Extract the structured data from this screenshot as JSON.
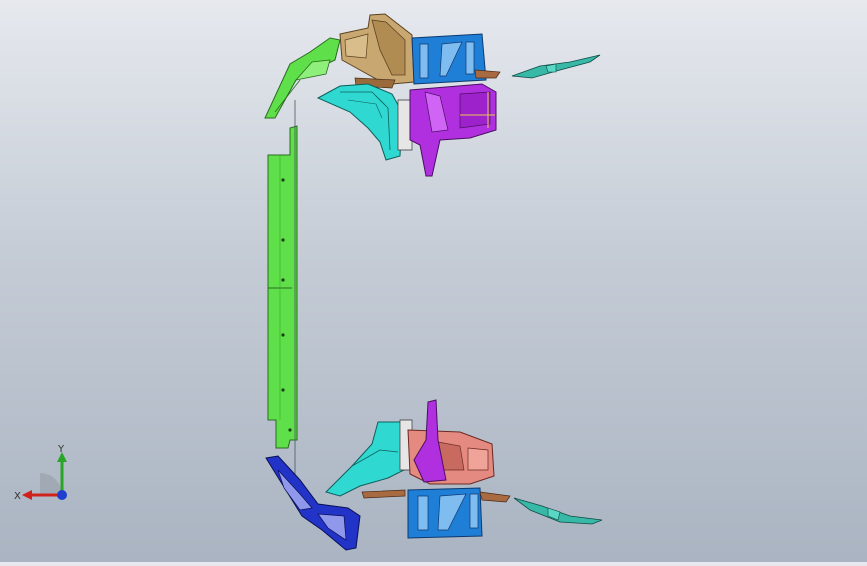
{
  "viewport": {
    "background_top": "#e6e9ee",
    "background_bottom": "#aab4c2"
  },
  "triad": {
    "x_label": "X",
    "y_label": "Y",
    "x_color": "#d0221c",
    "y_color": "#2aa52a",
    "z_color": "#1f3fcf"
  },
  "parts_colors": {
    "green": "#5fe04a",
    "tan": "#c8a870",
    "blue": "#1f7fd6",
    "cyan": "#2fd8d0",
    "magenta": "#b030e0",
    "navy": "#2233c8",
    "salmon": "#e58a80"
  }
}
